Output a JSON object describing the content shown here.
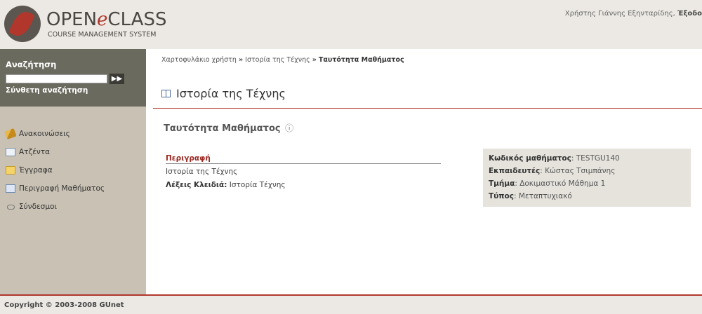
{
  "header": {
    "logo_word_open": "OPEN",
    "logo_word_e": "e",
    "logo_word_class": "CLASS",
    "logo_subtitle": "COURSE MANAGEMENT SYSTEM",
    "user_text": "Χρήστης Γιάννης Εξηνταρίδης,",
    "logout_label": "Έξοδο"
  },
  "sidebar": {
    "search_label": "Αναζήτηση",
    "search_input_value": "",
    "search_go_glyph": "▶▶",
    "advanced_search_label": "Σύνθετη αναζήτηση",
    "items": [
      {
        "label": "Ανακοινώσεις",
        "icon": "announcements-icon"
      },
      {
        "label": "Ατζέντα",
        "icon": "calendar-icon"
      },
      {
        "label": "Έγγραφα",
        "icon": "folder-icon"
      },
      {
        "label": "Περιγραφή Μαθήματος",
        "icon": "description-icon"
      },
      {
        "label": "Σύνδεσμοι",
        "icon": "link-icon"
      }
    ]
  },
  "breadcrumb": {
    "item1": "Χαρτοφυλάκιο χρήστη",
    "sep": "»",
    "item2": "Ιστορία της Τέχνης",
    "current": "Ταυτότητα Μαθήματος"
  },
  "main": {
    "course_title": "Ιστορία της Τέχνης",
    "section_title": "Ταυτότητα Μαθήματος",
    "help_glyph": "ⓘ",
    "description_heading": "Περιγραφή",
    "description_text": "Ιστορία της Τέχνης",
    "keywords_label": "Λέξεις Κλειδιά:",
    "keywords_value": "Ιστορία Τέχνης"
  },
  "info": {
    "code_label": "Κωδικός μαθήματος",
    "code_value": "TESTGU140",
    "instructor_label": "Εκπαιδευτές",
    "instructor_value": "Κώστας Τσιμπάνης",
    "department_label": "Τμήμα",
    "department_value": "Δοκιμαστικό Μάθημα 1",
    "type_label": "Τύπος",
    "type_value": "Μεταπτυχιακό"
  },
  "footer": {
    "copyright": "Copyright © 2003-2008 GUnet"
  },
  "colors": {
    "brand_red": "#b1362c",
    "sidebar_bg": "#c8c1b4",
    "search_bg": "#6b6a5e",
    "header_bg": "#ece9e4"
  }
}
